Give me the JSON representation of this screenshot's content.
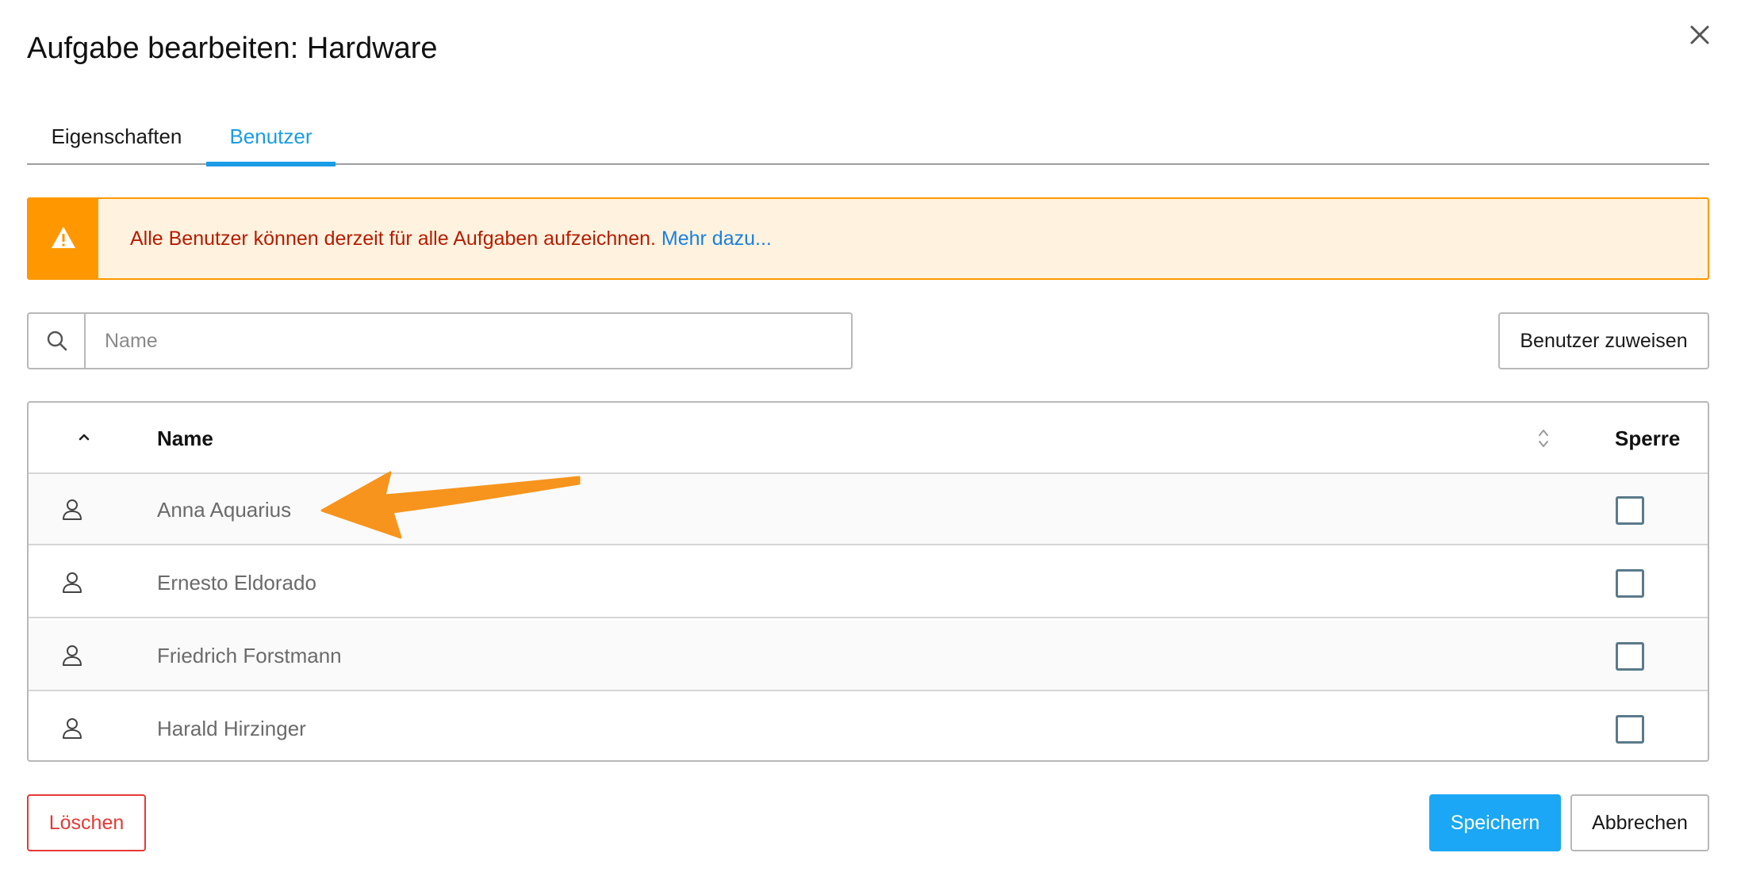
{
  "dialog": {
    "title": "Aufgabe bearbeiten: Hardware",
    "close_icon": "close-icon"
  },
  "tabs": [
    {
      "label": "Eigenschaften",
      "active": false
    },
    {
      "label": "Benutzer",
      "active": true
    }
  ],
  "alert": {
    "icon": "warning-icon",
    "text": "Alle Benutzer können derzeit für alle Aufgaben aufzeichnen.",
    "link": "Mehr dazu..."
  },
  "search": {
    "icon": "search-icon",
    "placeholder": "Name",
    "value": ""
  },
  "assign_button": "Benutzer zuweisen",
  "table": {
    "columns": {
      "name": "Name",
      "lock": "Sperre"
    },
    "rows": [
      {
        "name": "Anna Aquarius",
        "locked": false
      },
      {
        "name": "Ernesto Eldorado",
        "locked": false
      },
      {
        "name": "Friedrich Forstmann",
        "locked": false
      },
      {
        "name": "Harald Hirzinger",
        "locked": false
      }
    ]
  },
  "footer": {
    "delete": "Löschen",
    "save": "Speichern",
    "cancel": "Abbrechen"
  },
  "colors": {
    "accent": "#1b9ce6",
    "warning": "#ff9800",
    "danger": "#e53935",
    "annotation_arrow": "#f7941d"
  }
}
